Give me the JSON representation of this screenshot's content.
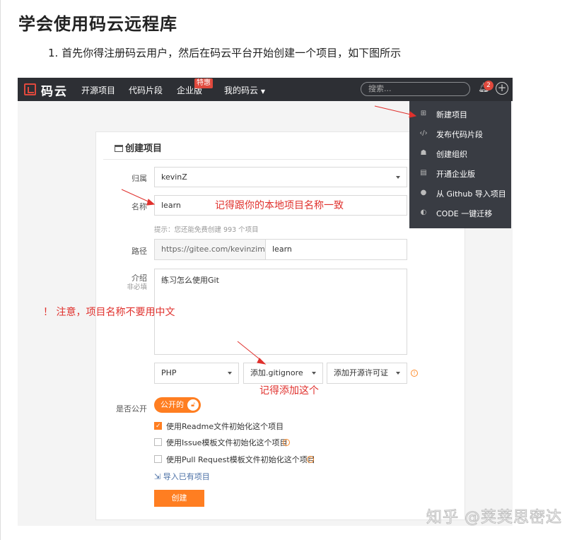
{
  "article": {
    "heading": "学会使用码云远程库",
    "step_number": "1.",
    "step_text": "首先你得注册码云用户，然后在码云平台开始创建一个项目，如下图所示"
  },
  "topbar": {
    "logo_text": "码云",
    "nav": [
      "开源项目",
      "代码片段",
      "企业版",
      "我的码云"
    ],
    "enterprise_badge": "特惠",
    "search_placeholder": "搜索...",
    "notification_count": "2"
  },
  "dropdown": {
    "items": [
      {
        "label": "新建项目",
        "icon": "plus-square-icon"
      },
      {
        "label": "发布代码片段",
        "icon": "code-icon"
      },
      {
        "label": "创建组织",
        "icon": "group-icon"
      },
      {
        "label": "开通企业版",
        "icon": "building-icon"
      },
      {
        "label": "从 Github 导入项目",
        "icon": "github-icon"
      },
      {
        "label": "CODE 一键迁移",
        "icon": "migrate-icon"
      }
    ]
  },
  "form": {
    "title": "创建项目",
    "owner_label": "归属",
    "owner_value": "kevinZ",
    "name_label": "名称",
    "name_value": "learn",
    "name_hint": "提示：您还能免费创建 993 个项目",
    "path_label": "路径",
    "path_prefix": "https://gitee.com/kevinzimao/",
    "path_value": "learn",
    "desc_label": "介绍",
    "desc_optional": "非必填",
    "desc_value": "练习怎么使用Git",
    "language_value": "PHP",
    "gitignore_value": "添加.gitignore",
    "license_value": "添加开源许可证",
    "public_label": "是否公开",
    "public_toggle": "公开的",
    "checkboxes": [
      {
        "label": "使用Readme文件初始化这个项目",
        "checked": true,
        "info": false
      },
      {
        "label": "使用Issue模板文件初始化这个项目",
        "checked": false,
        "info": true
      },
      {
        "label": "使用Pull Request模板文件初始化这个项目",
        "checked": false,
        "info": true
      }
    ],
    "import_link": "导入已有项目",
    "submit_label": "创建"
  },
  "annotations": {
    "name_note": "记得跟你的本地项目名称一致",
    "chinese_warning": "！ 注意，项目名称不要用中文",
    "gitignore_note": "记得添加这个"
  },
  "watermark": "知乎 @荚荚思密达",
  "colors": {
    "accent": "#ff7e21",
    "nav_bg": "#2d2f34",
    "dropdown_bg": "#393c43",
    "annotation_red": "#e0312d"
  }
}
